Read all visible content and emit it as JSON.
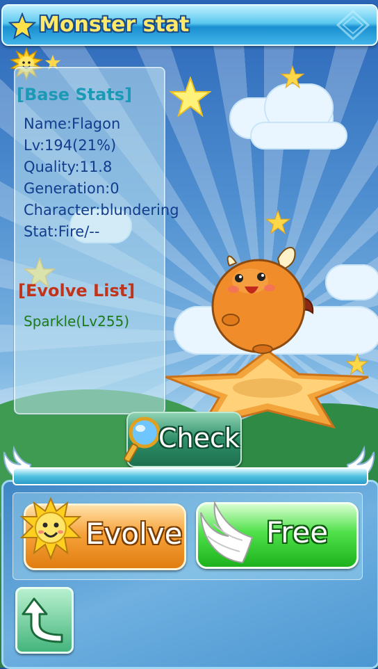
{
  "header": {
    "title": "Monster stat"
  },
  "base_stats": {
    "heading": "[Base Stats]",
    "name": "Name:Flagon",
    "level": "Lv:194(21%)",
    "quality": "Quality:11.8",
    "generation": "Generation:0",
    "character": "Character:blundering",
    "stat": "Stat:Fire/--"
  },
  "evolve_list": {
    "heading": "[Evolve List]",
    "items": [
      "Sparkle(Lv255)"
    ]
  },
  "buttons": {
    "check": "Check",
    "evolve": "Evolve",
    "free": "Free"
  },
  "icons": {
    "title": "star-icon",
    "check": "magnifier-icon",
    "evolve": "sun-crown-icon",
    "free": "wing-icon",
    "back": "back-arrow-icon"
  },
  "colors": {
    "base_stats_heading": "#1b9ab5",
    "evolve_heading": "#c0341c",
    "stat_text": "#123c8c",
    "evolve_item": "#1f7a18"
  }
}
